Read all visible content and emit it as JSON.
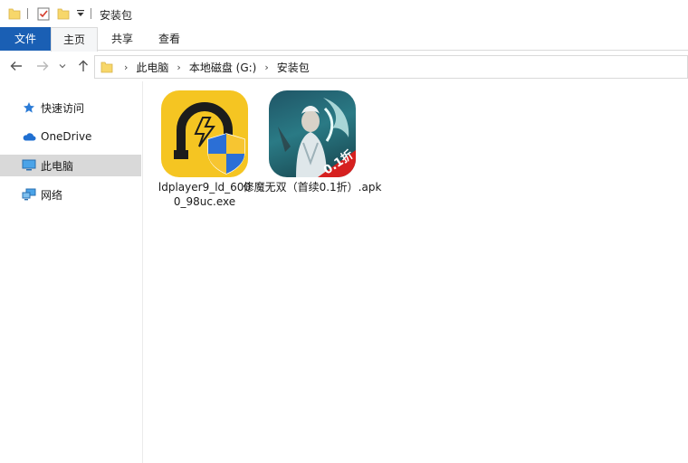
{
  "window": {
    "title": "安装包"
  },
  "ribbon": {
    "tabs": [
      "文件",
      "主页",
      "共享",
      "查看"
    ]
  },
  "address": {
    "breadcrumbs": [
      "此电脑",
      "本地磁盘 (G:)",
      "安装包"
    ]
  },
  "sidebar": {
    "items": [
      {
        "label": "快速访问",
        "icon": "star-icon"
      },
      {
        "label": "OneDrive",
        "icon": "cloud-icon"
      },
      {
        "label": "此电脑",
        "icon": "computer-icon",
        "selected": true
      },
      {
        "label": "网络",
        "icon": "network-icon"
      }
    ]
  },
  "files": [
    {
      "name": "ldplayer9_ld_6000_98uc.exe",
      "icon": "ldplayer-shield-icon"
    },
    {
      "name": "修魔无双（首续0.1折）.apk",
      "icon": "game-apk-icon",
      "badge": "0.1折"
    }
  ],
  "colors": {
    "accent": "#1a5fb4",
    "selected_bg": "#d9d9d9",
    "ldplayer_yellow": "#f5c522",
    "shield_blue": "#2b6fd6",
    "badge_red": "#d6201f"
  }
}
